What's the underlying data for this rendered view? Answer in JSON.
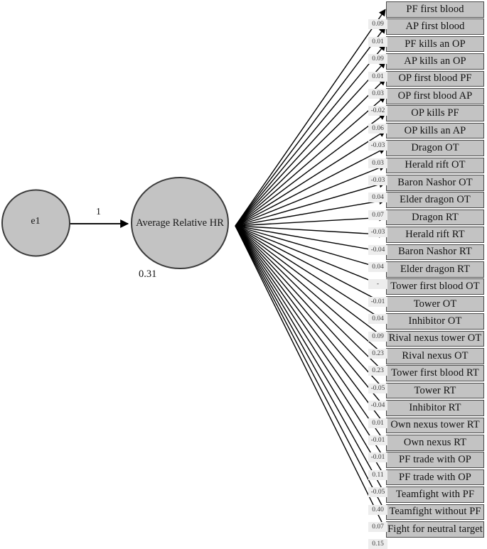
{
  "diagram": {
    "type": "sem-path-diagram",
    "latent": {
      "name": "Average Relative HR",
      "label": "Average Relative HR",
      "variance_label": "0.31"
    },
    "error_term": {
      "name": "e1",
      "label": "e1",
      "loading_label": "1"
    },
    "colors": {
      "node_fill": "#c3c3c3",
      "node_stroke": "#3c3c3c",
      "box_fill": "#c3c3c3",
      "box_stroke": "#4a4a4a",
      "coef_fill": "#ededed",
      "path_stroke": "#000000",
      "page_background": "#ffffff"
    },
    "indicators": [
      {
        "label": "PF first blood",
        "coefficient": ""
      },
      {
        "label": "AP first blood",
        "coefficient": "0.09"
      },
      {
        "label": "PF kills an OP",
        "coefficient": "0.01"
      },
      {
        "label": "AP kills an OP",
        "coefficient": "0.09"
      },
      {
        "label": "OP first blood PF",
        "coefficient": "0.01"
      },
      {
        "label": "OP first blood AP",
        "coefficient": "0.03"
      },
      {
        "label": "OP kills PF",
        "coefficient": "-0.02"
      },
      {
        "label": "OP kills an AP",
        "coefficient": "0.06"
      },
      {
        "label": "Dragon OT",
        "coefficient": "-0.03"
      },
      {
        "label": "Herald rift OT",
        "coefficient": "0.03"
      },
      {
        "label": "Baron Nashor OT",
        "coefficient": "-0.03"
      },
      {
        "label": "Elder dragon OT",
        "coefficient": "0.04"
      },
      {
        "label": "Dragon RT",
        "coefficient": "0.07"
      },
      {
        "label": "Herald rift RT",
        "coefficient": "-0.03"
      },
      {
        "label": "Baron Nashor RT",
        "coefficient": "-0.04"
      },
      {
        "label": "Elder dragon RT",
        "coefficient": "0.04"
      },
      {
        "label": "Tower first blood OT",
        "coefficient": "-"
      },
      {
        "label": "Tower OT",
        "coefficient": "-0.01"
      },
      {
        "label": "Inhibitor OT",
        "coefficient": "0.04"
      },
      {
        "label": "Rival nexus tower OT",
        "coefficient": "0.09"
      },
      {
        "label": "Rival nexus OT",
        "coefficient": "0.23"
      },
      {
        "label": "Tower first blood RT",
        "coefficient": "0.23"
      },
      {
        "label": "Tower RT",
        "coefficient": "-0.05"
      },
      {
        "label": "Inhibitor RT",
        "coefficient": "-0.04"
      },
      {
        "label": "Own nexus tower RT",
        "coefficient": "0.01"
      },
      {
        "label": "Own nexus RT",
        "coefficient": "-0.01"
      },
      {
        "label": "PF trade with OP",
        "coefficient": "-0.01"
      },
      {
        "label": "PF trade with OP",
        "coefficient": "0.11"
      },
      {
        "label": "Teamfight with PF",
        "coefficient": "-0.05"
      },
      {
        "label": "Teamfight without PF",
        "coefficient": "0.40"
      },
      {
        "label": "Fight for neutral target",
        "coefficient": "0.07"
      }
    ],
    "trailing_coefficients": [
      "0.15"
    ]
  }
}
